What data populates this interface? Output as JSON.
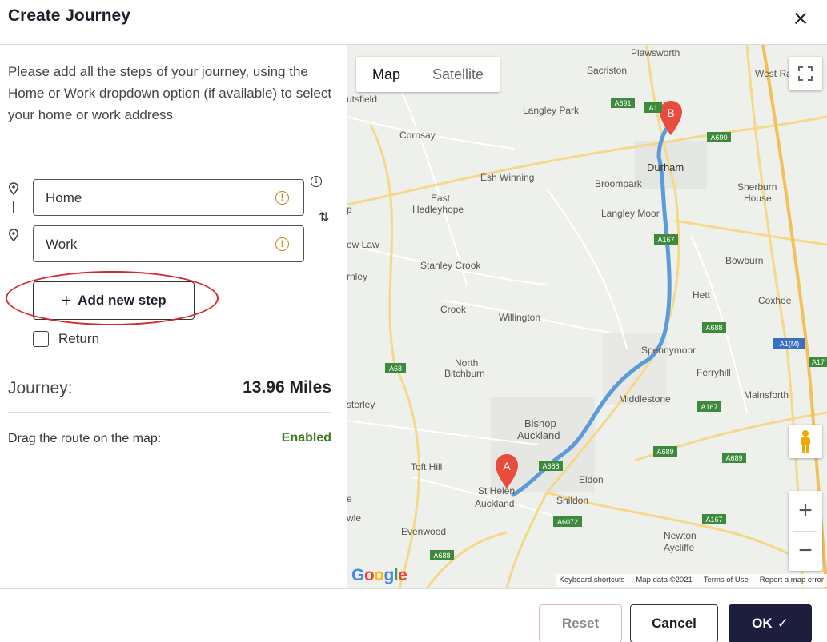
{
  "dialog": {
    "title": "Create Journey",
    "close_icon": "close-icon"
  },
  "form": {
    "instructions": "Please add all the steps of your journey, using the Home or Work dropdown option (if available) to select your home or work address",
    "steps": [
      {
        "value": "Home",
        "icon": "location-pin-icon",
        "status_icon": "warning-icon"
      },
      {
        "value": "Work",
        "icon": "location-pin-icon",
        "status_icon": "warning-icon"
      }
    ],
    "add_step_label": "Add new step",
    "return_label": "Return",
    "return_checked": false,
    "journey_label": "Journey:",
    "journey_value": "13.96 Miles",
    "drag_label": "Drag the route on the map:",
    "drag_value": "Enabled"
  },
  "map": {
    "type_options": [
      "Map",
      "Satellite"
    ],
    "selected_type": "Map",
    "places": [
      {
        "name": "Plawsworth"
      },
      {
        "name": "Sacriston"
      },
      {
        "name": "West Ra"
      },
      {
        "name": "utsfield"
      },
      {
        "name": "Langley Park"
      },
      {
        "name": "Cornsay"
      },
      {
        "name": "Durham"
      },
      {
        "name": "Esh Winning"
      },
      {
        "name": "Broompark"
      },
      {
        "name": "Sherburn"
      },
      {
        "name": "House"
      },
      {
        "name": "East"
      },
      {
        "name": "Hedleyhope"
      },
      {
        "name": "Langley Moor"
      },
      {
        "name": "ow Law"
      },
      {
        "name": "Stanley Crook"
      },
      {
        "name": "Bowburn"
      },
      {
        "name": "rnley"
      },
      {
        "name": "Hett"
      },
      {
        "name": "Coxhoe"
      },
      {
        "name": "Crook"
      },
      {
        "name": "Willington"
      },
      {
        "name": "Spennymoor"
      },
      {
        "name": "North"
      },
      {
        "name": "Bitchburn"
      },
      {
        "name": "Ferryhill"
      },
      {
        "name": "Mainsforth"
      },
      {
        "name": "Middlestone"
      },
      {
        "name": "sterley"
      },
      {
        "name": "Bishop"
      },
      {
        "name": "Auckland"
      },
      {
        "name": "Toft Hill"
      },
      {
        "name": "Eldon"
      },
      {
        "name": "St Helen"
      },
      {
        "name": "Auckland"
      },
      {
        "name": "Shildon"
      },
      {
        "name": "wle"
      },
      {
        "name": "Evenwood"
      },
      {
        "name": "Newton"
      },
      {
        "name": "Aycliffe"
      },
      {
        "name": "e"
      },
      {
        "name": "p"
      }
    ],
    "road_labels": [
      "A691",
      "A1",
      "A690",
      "A167",
      "A688",
      "A1(M)",
      "A68",
      "A167",
      "A689",
      "A689",
      "A688",
      "A6072",
      "A167",
      "A688",
      "A17"
    ],
    "marker_a": "A",
    "marker_b": "B",
    "google_logo": "Google",
    "footer": [
      "Keyboard shortcuts",
      "Map data ©2021",
      "Terms of Use",
      "Report a map error"
    ],
    "route_color": "#5b9bd9"
  },
  "actions": {
    "reset_label": "Reset",
    "cancel_label": "Cancel",
    "ok_label": "OK"
  }
}
